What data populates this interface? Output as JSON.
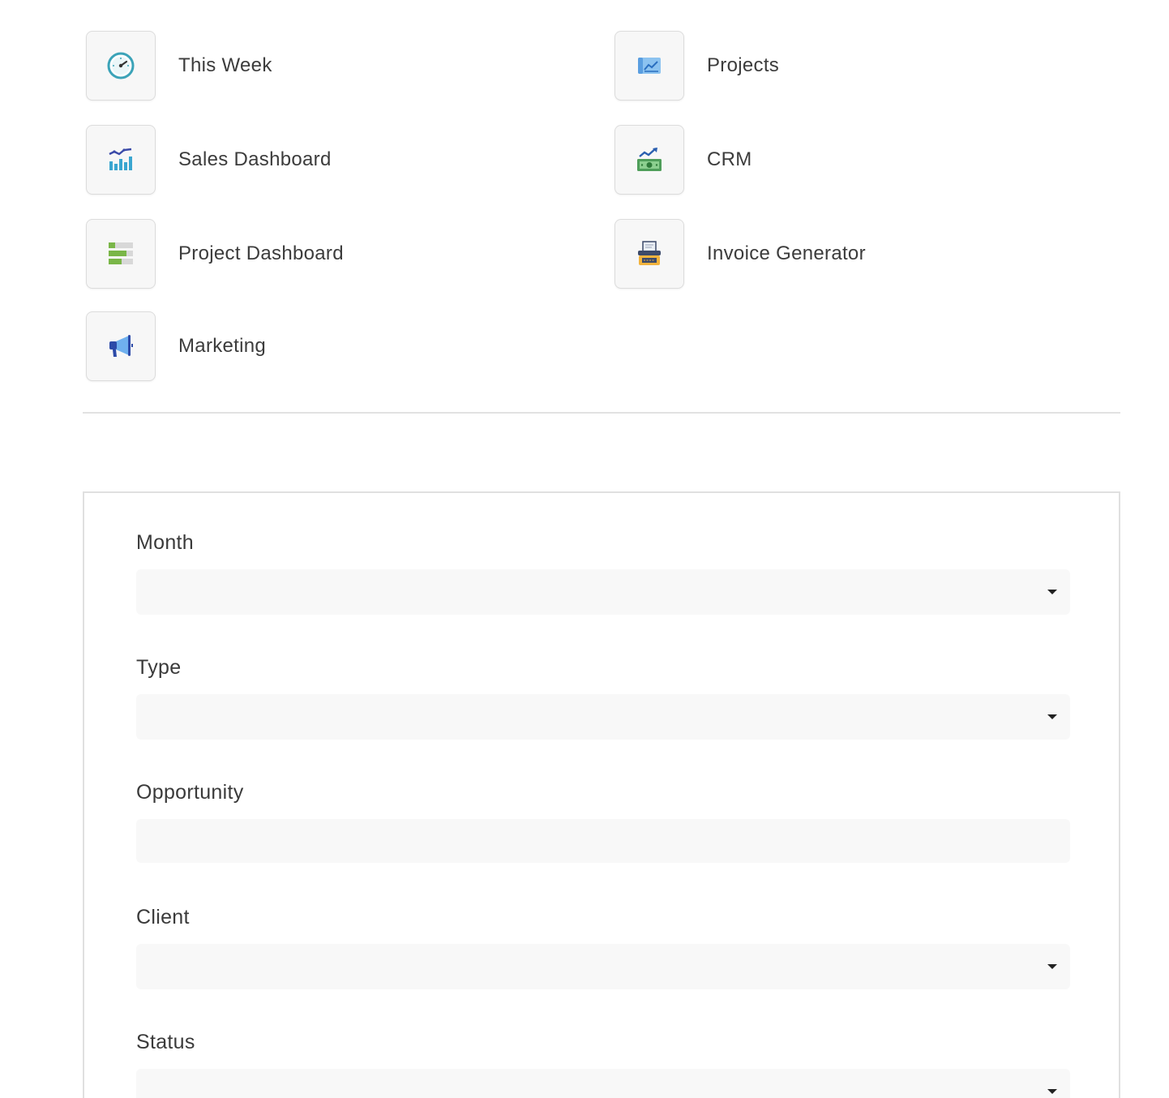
{
  "links": [
    {
      "label": "This Week",
      "icon": "gauge-icon"
    },
    {
      "label": "Projects",
      "icon": "blueprint-chart-icon"
    },
    {
      "label": "Sales Dashboard",
      "icon": "bar-chart-icon"
    },
    {
      "label": "CRM",
      "icon": "money-growth-icon"
    },
    {
      "label": "Project Dashboard",
      "icon": "progress-bars-icon"
    },
    {
      "label": "Invoice Generator",
      "icon": "typewriter-icon"
    },
    {
      "label": "Marketing",
      "icon": "megaphone-icon"
    }
  ],
  "form": {
    "fields": [
      {
        "label": "Month",
        "type": "select",
        "value": ""
      },
      {
        "label": "Type",
        "type": "select",
        "value": ""
      },
      {
        "label": "Opportunity",
        "type": "text",
        "value": ""
      },
      {
        "label": "Client",
        "type": "select",
        "value": ""
      },
      {
        "label": "Status",
        "type": "select",
        "value": ""
      }
    ]
  }
}
